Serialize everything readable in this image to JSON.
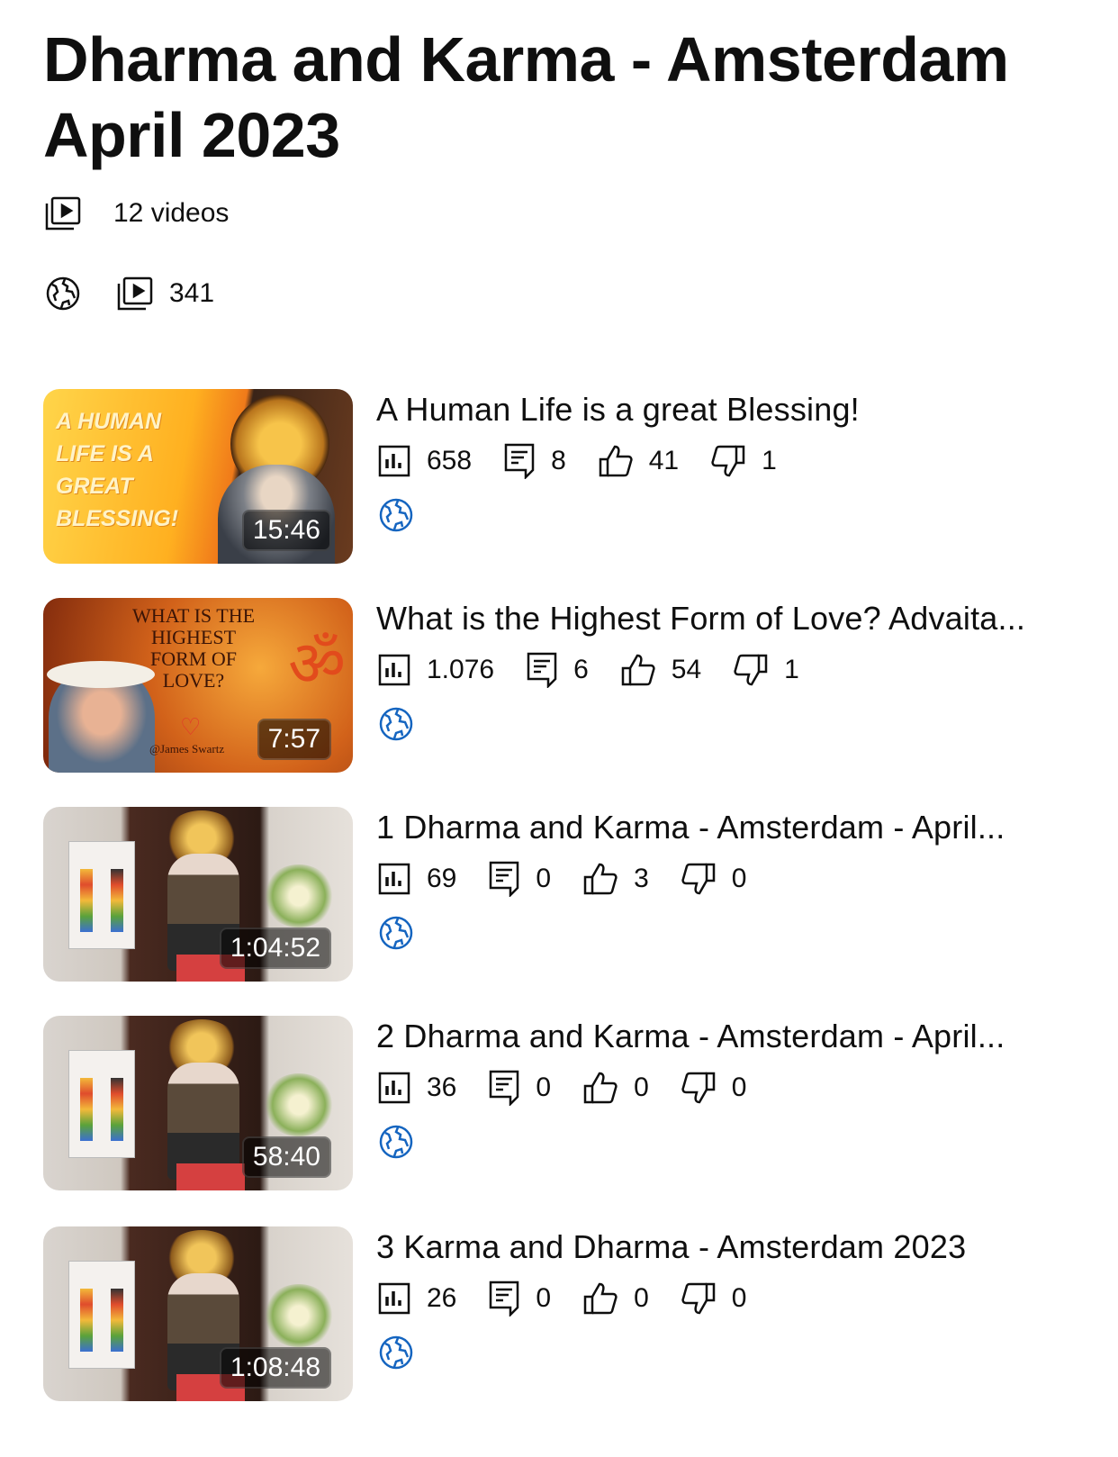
{
  "playlist": {
    "title": "Dharma and Karma - Amsterdam April 2023",
    "video_count": "12 videos",
    "views": "341",
    "visibility_icon": "globe-icon"
  },
  "videos": [
    {
      "title": "A Human Life is a great Blessing!",
      "duration": "15:46",
      "views": "658",
      "comments": "8",
      "likes": "41",
      "dislikes": "1",
      "thumb_text": "A HUMAN LIFE IS A GREAT BLESSING!"
    },
    {
      "title": "What is the Highest Form of Love? Advaita...",
      "duration": "7:57",
      "views": "1.076",
      "comments": "6",
      "likes": "54",
      "dislikes": "1",
      "thumb_text": "WHAT IS THE HIGHEST FORM OF LOVE?",
      "thumb_handle": "@James Swartz"
    },
    {
      "title": "1 Dharma and Karma - Amsterdam - April...",
      "duration": "1:04:52",
      "views": "69",
      "comments": "0",
      "likes": "3",
      "dislikes": "0"
    },
    {
      "title": "2 Dharma and Karma - Amsterdam - April...",
      "duration": "58:40",
      "views": "36",
      "comments": "0",
      "likes": "0",
      "dislikes": "0"
    },
    {
      "title": "3 Karma and Dharma - Amsterdam 2023",
      "duration": "1:08:48",
      "views": "26",
      "comments": "0",
      "likes": "0",
      "dislikes": "0"
    }
  ],
  "colors": {
    "text": "#0f0f0f",
    "globe_accent": "#1565c0"
  }
}
